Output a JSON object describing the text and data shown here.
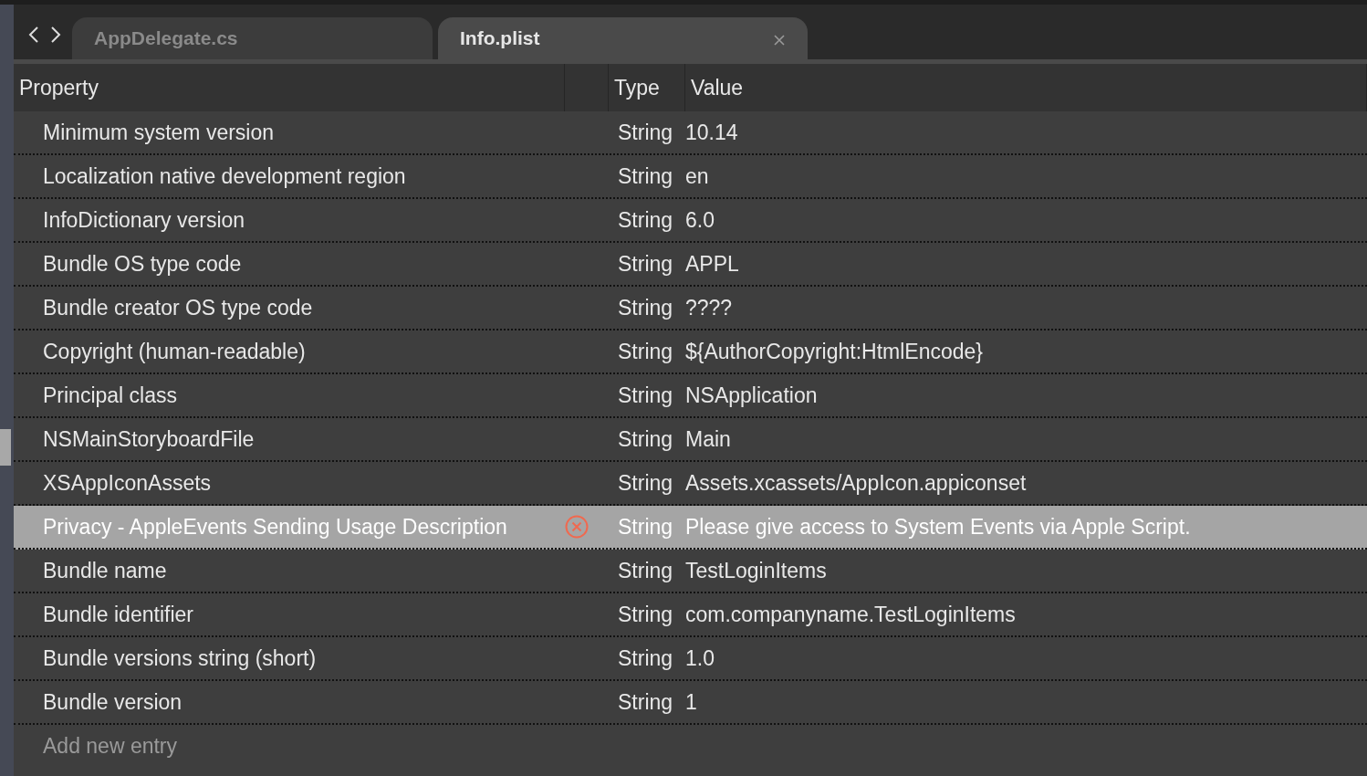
{
  "tabs": [
    {
      "label": "AppDelegate.cs",
      "selected": false,
      "closable": false
    },
    {
      "label": "Info.plist",
      "selected": true,
      "closable": true
    }
  ],
  "table": {
    "columns": [
      "Property",
      "Type",
      "Value"
    ],
    "rows": [
      {
        "property": "Minimum system version",
        "type": "String",
        "value": "10.14",
        "selected": false,
        "error": false
      },
      {
        "property": "Localization native development region",
        "type": "String",
        "value": "en",
        "selected": false,
        "error": false
      },
      {
        "property": "InfoDictionary version",
        "type": "String",
        "value": "6.0",
        "selected": false,
        "error": false
      },
      {
        "property": "Bundle OS type code",
        "type": "String",
        "value": "APPL",
        "selected": false,
        "error": false
      },
      {
        "property": "Bundle creator OS type code",
        "type": "String",
        "value": "????",
        "selected": false,
        "error": false
      },
      {
        "property": "Copyright (human-readable)",
        "type": "String",
        "value": "${AuthorCopyright:HtmlEncode}",
        "selected": false,
        "error": false
      },
      {
        "property": "Principal class",
        "type": "String",
        "value": "NSApplication",
        "selected": false,
        "error": false
      },
      {
        "property": "NSMainStoryboardFile",
        "type": "String",
        "value": "Main",
        "selected": false,
        "error": false
      },
      {
        "property": "XSAppIconAssets",
        "type": "String",
        "value": "Assets.xcassets/AppIcon.appiconset",
        "selected": false,
        "error": false
      },
      {
        "property": "Privacy - AppleEvents Sending Usage Description",
        "type": "String",
        "value": "Please give access to System Events via Apple Script.",
        "selected": true,
        "error": true
      },
      {
        "property": "Bundle name",
        "type": "String",
        "value": "TestLoginItems",
        "selected": false,
        "error": false
      },
      {
        "property": "Bundle identifier",
        "type": "String",
        "value": "com.companyname.TestLoginItems",
        "selected": false,
        "error": false
      },
      {
        "property": "Bundle versions string (short)",
        "type": "String",
        "value": "1.0",
        "selected": false,
        "error": false
      },
      {
        "property": "Bundle version",
        "type": "String",
        "value": "1",
        "selected": false,
        "error": false
      }
    ],
    "add_entry": "Add new entry"
  }
}
